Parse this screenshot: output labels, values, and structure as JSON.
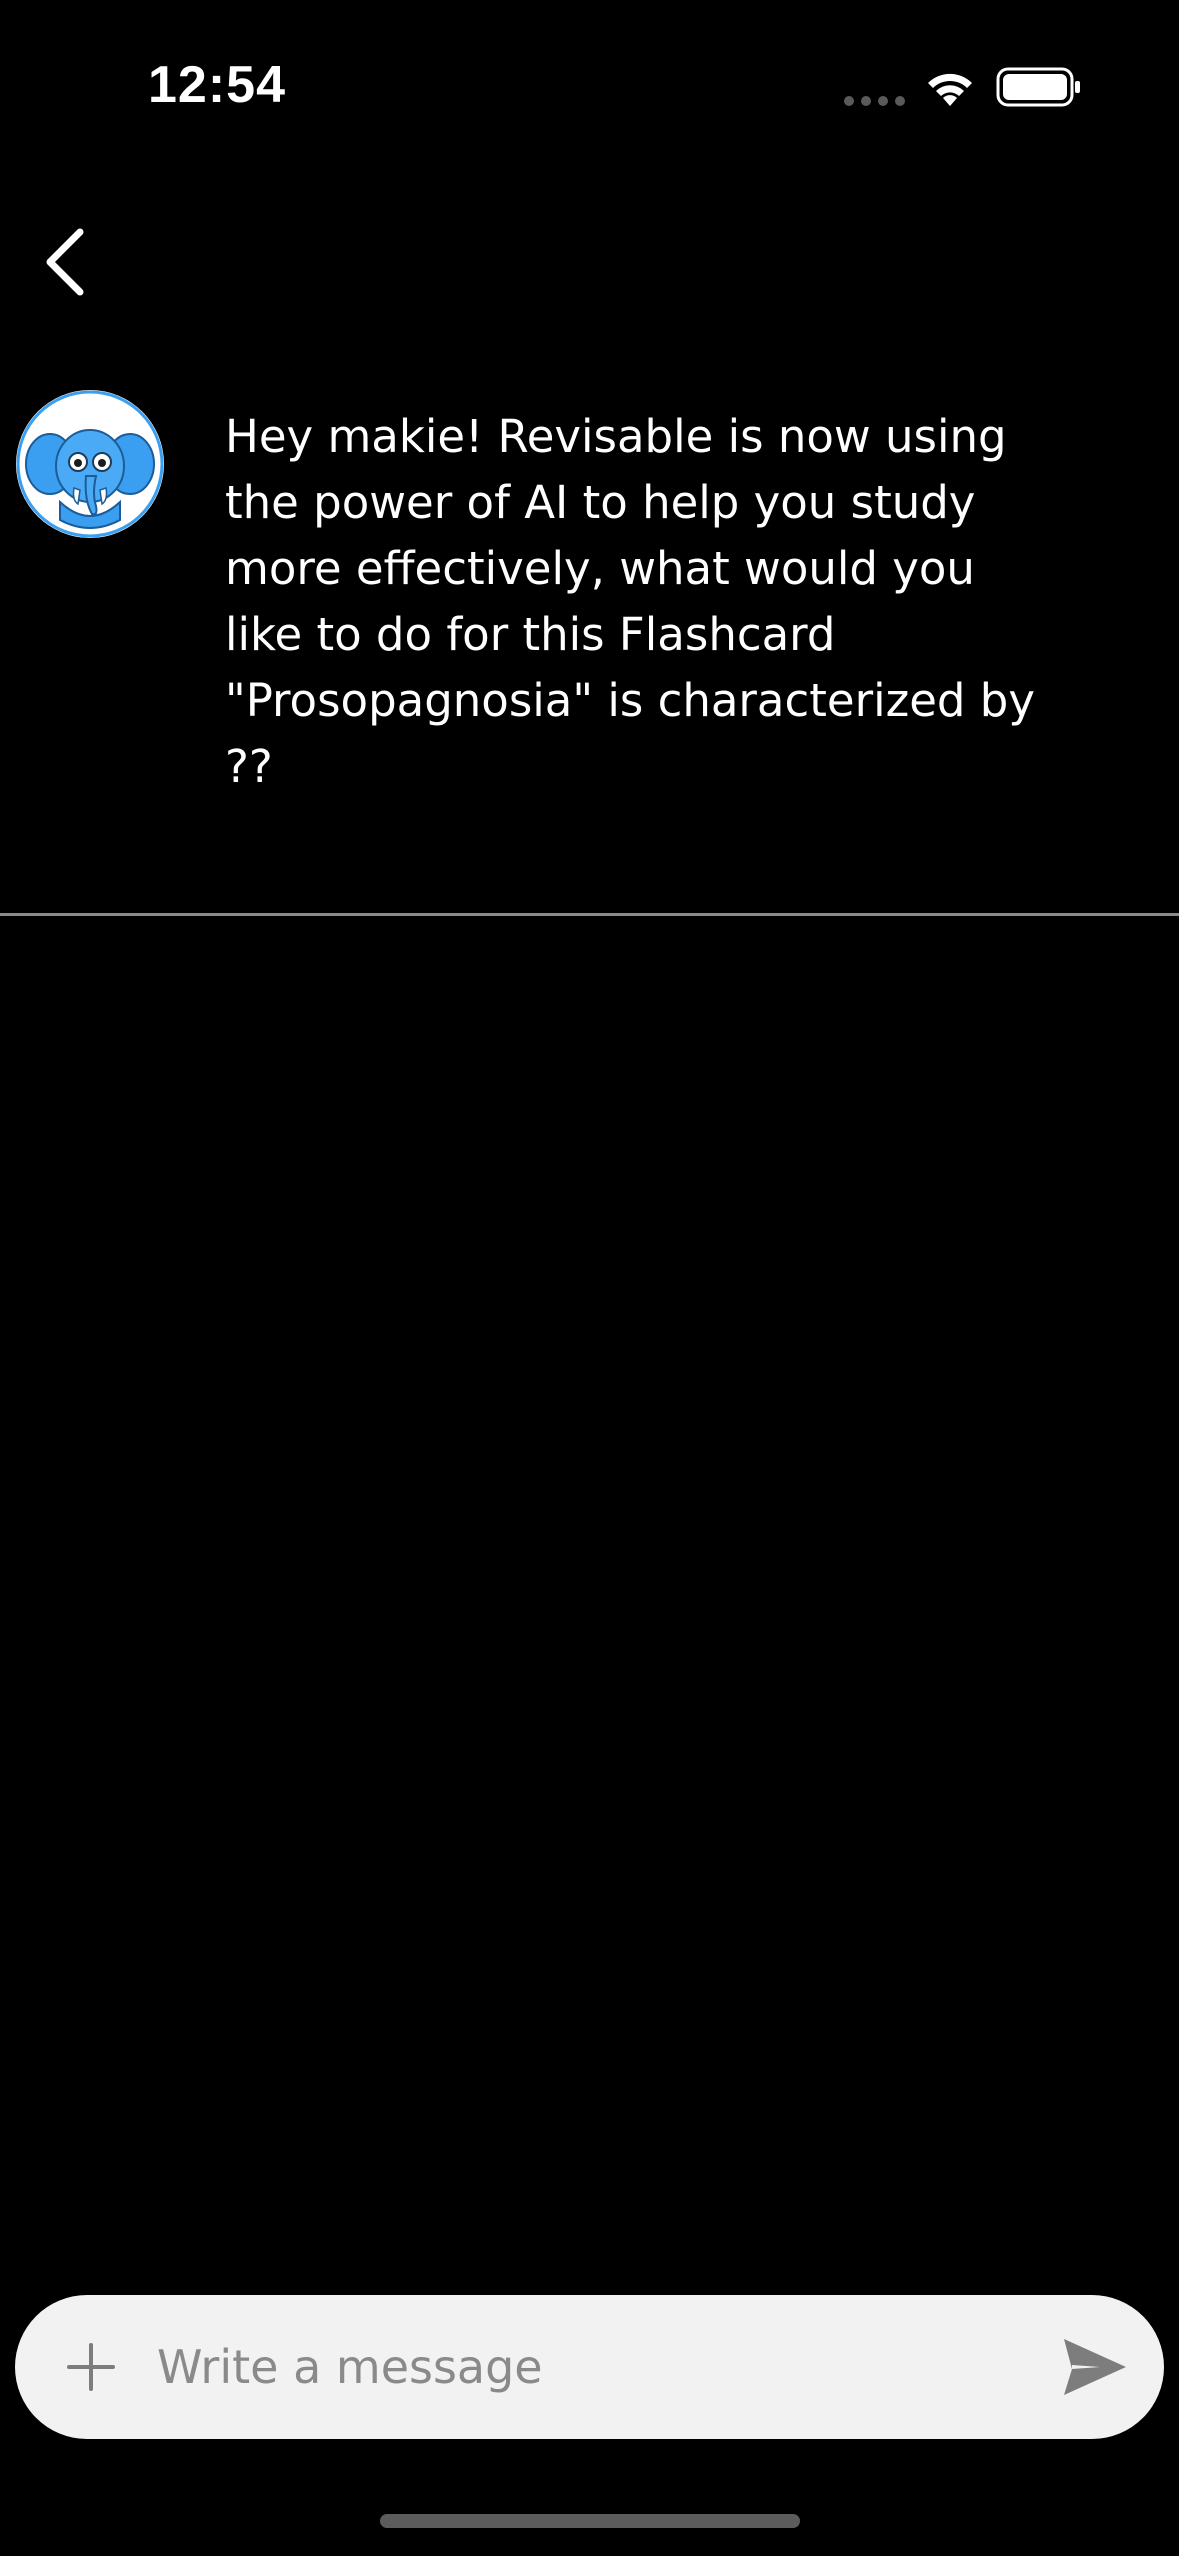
{
  "status_bar": {
    "time": "12:54",
    "icons": [
      "signal-icon",
      "wifi-icon",
      "battery-icon"
    ]
  },
  "nav": {
    "back_icon": "chevron-left-icon"
  },
  "chat": {
    "avatar_icon": "elephant-mascot-icon",
    "message": "Hey makie! Revisable is now using the power of AI to help you study more effectively, what would you like to do for this Flashcard \"Prosopagnosia\" is characterized by ??"
  },
  "composer": {
    "add_icon": "plus-icon",
    "placeholder": "Write a message",
    "value": "",
    "send_icon": "send-icon"
  },
  "colors": {
    "background": "#000000",
    "text": "#ffffff",
    "composer_bg": "#f2f2f2",
    "placeholder": "#8a8a8a",
    "icon_gray": "#7d7d7d",
    "mascot_blue": "#3a9ff0"
  }
}
